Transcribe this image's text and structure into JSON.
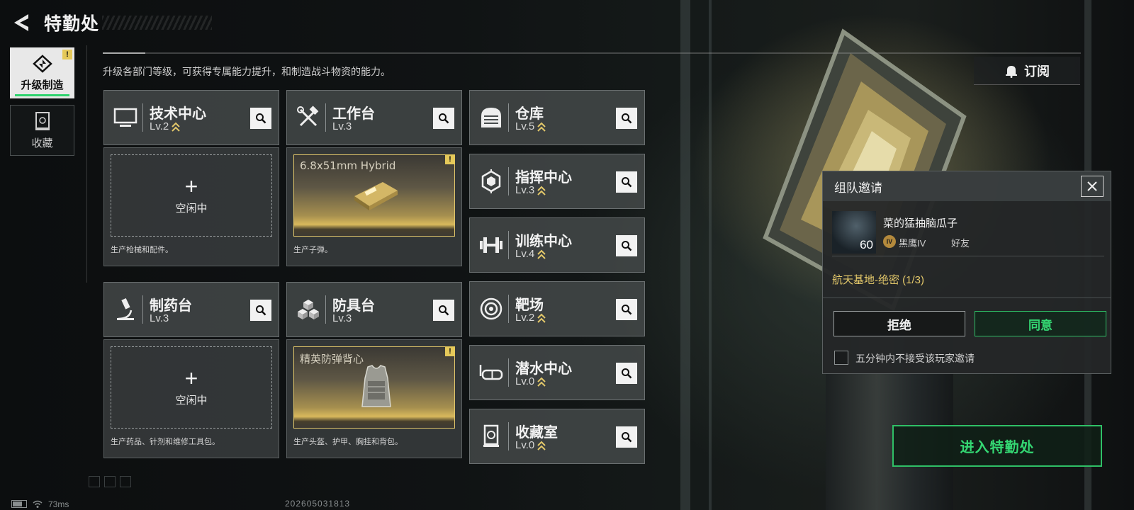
{
  "header": {
    "title": "特勤处"
  },
  "nav": [
    {
      "label": "升级制造",
      "active": true,
      "badge": "!",
      "icon": "upgrade-icon"
    },
    {
      "label": "收藏",
      "active": false,
      "icon": "collection-icon"
    }
  ],
  "subtitle": "升级各部门等级，可获得专属能力提升，和制造战斗物资的能力。",
  "departments": [
    {
      "name": "技术中心",
      "level": "Lv.2",
      "icon": "monitor-icon"
    },
    {
      "name": "工作台",
      "level": "Lv.3",
      "icon": "tools-icon"
    },
    {
      "name": "仓库",
      "level": "Lv.5",
      "icon": "warehouse-icon"
    },
    {
      "name": "指挥中心",
      "level": "Lv.3",
      "icon": "chip-icon"
    },
    {
      "name": "训练中心",
      "level": "Lv.4",
      "icon": "dumbbell-icon"
    },
    {
      "name": "制药台",
      "level": "Lv.3",
      "icon": "microscope-icon"
    },
    {
      "name": "防具台",
      "level": "Lv.3",
      "icon": "cubes-icon"
    },
    {
      "name": "靶场",
      "level": "Lv.2",
      "icon": "target-icon"
    },
    {
      "name": "潜水中心",
      "level": "Lv.0",
      "icon": "goggles-icon"
    },
    {
      "name": "收藏室",
      "level": "Lv.0",
      "icon": "vault-icon"
    }
  ],
  "slots": [
    {
      "state": "idle",
      "idle_text": "空闲中",
      "desc": "生产枪械和配件。"
    },
    {
      "state": "producing",
      "item": "6.8x51mm Hybrid",
      "desc": "生产子弹。",
      "badge": "!"
    },
    {
      "state": "idle",
      "idle_text": "空闲中",
      "desc": "生产药品、针剂和维修工具包。"
    },
    {
      "state": "producing",
      "item": "精英防弹背心",
      "desc": "生产头盔、护甲、胸挂和背包。",
      "badge": "!"
    }
  ],
  "subscribe": {
    "label": "订阅"
  },
  "invite": {
    "title": "组队邀请",
    "player_name": "菜的猛抽脑瓜子",
    "player_level": "60",
    "rank_badge": "IV",
    "rank": "黑鹰IV",
    "relation": "好友",
    "mission": "航天基地-绝密 (1/3)",
    "reject": "拒绝",
    "accept": "同意",
    "block_label": "五分钟内不接受该玩家邀请"
  },
  "enter_button": "进入特勤处",
  "status": {
    "ping": "73ms",
    "timestamp": "202605031813"
  },
  "colors": {
    "accent_green": "#34d873",
    "accent_gold": "#e3c86a"
  }
}
